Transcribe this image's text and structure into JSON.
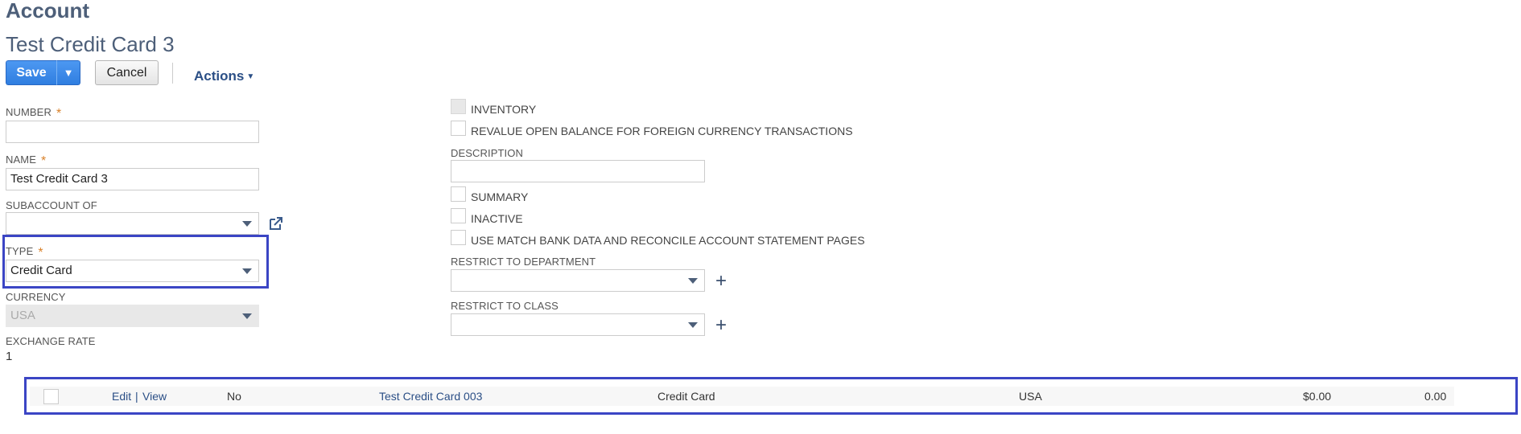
{
  "header": {
    "record_type": "Account",
    "record_name": "Test Credit Card 3"
  },
  "toolbar": {
    "save_label": "Save",
    "save_menu_icon": "triangle-down",
    "cancel_label": "Cancel",
    "actions_label": "Actions"
  },
  "left_fields": {
    "number": {
      "label": "NUMBER",
      "required": "*",
      "value": ""
    },
    "name": {
      "label": "NAME",
      "required": "*",
      "value": "Test Credit Card 3"
    },
    "subaccount": {
      "label": "SUBACCOUNT OF",
      "value": "",
      "link_icon": "open-external"
    },
    "type": {
      "label": "TYPE",
      "required": "*",
      "value": "Credit Card"
    },
    "currency": {
      "label": "CURRENCY",
      "value": "USA"
    },
    "exchange_rate": {
      "label": "EXCHANGE RATE",
      "value": "1"
    }
  },
  "right_fields": {
    "inventory": {
      "label": "INVENTORY",
      "checked": false,
      "disabled": true
    },
    "revalue": {
      "label": "REVALUE OPEN BALANCE FOR FOREIGN CURRENCY TRANSACTIONS",
      "checked": false
    },
    "description": {
      "label": "DESCRIPTION",
      "value": ""
    },
    "summary": {
      "label": "SUMMARY",
      "checked": false
    },
    "inactive": {
      "label": "INACTIVE",
      "checked": false
    },
    "match_bank": {
      "label": "USE MATCH BANK DATA AND RECONCILE ACCOUNT STATEMENT PAGES",
      "checked": false
    },
    "restrict_department": {
      "label": "RESTRICT TO DEPARTMENT",
      "value": "",
      "add_icon": "+"
    },
    "restrict_class": {
      "label": "RESTRICT TO CLASS",
      "value": "",
      "add_icon": "+"
    }
  },
  "result_row": {
    "edit": "Edit",
    "separator": "|",
    "view": "View",
    "inactive": "No",
    "name": "Test Credit Card 003",
    "type": "Credit Card",
    "currency": "USA",
    "balance": "$0.00",
    "amount": "0.00"
  },
  "colors": {
    "accent_blue": "#2f7ee0",
    "highlight_border": "#3b45c4",
    "required_star": "#d9822b",
    "title_text": "#4d5f79"
  }
}
